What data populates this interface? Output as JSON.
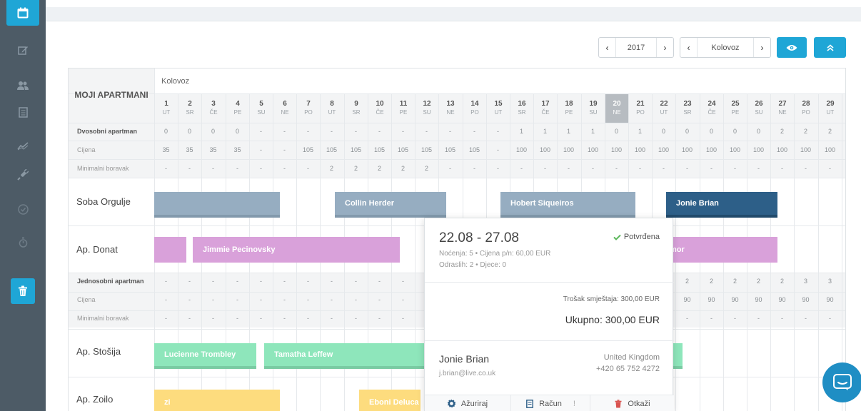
{
  "toolbar": {
    "year": "2017",
    "month": "Kolovoz",
    "prev": "‹",
    "next": "›",
    "view_icon": "eye-icon",
    "collapse_icon": "double-chevron-up-icon"
  },
  "sidebar": {
    "icons": [
      "calendar-icon",
      "edit-icon",
      "users-icon",
      "document-icon",
      "chart-icon",
      "plug-icon",
      "check-circle-icon",
      "timer-icon",
      "trash-icon"
    ]
  },
  "calendar": {
    "header_label": "MOJI APARTMANI",
    "month_label": "Kolovoz",
    "days": [
      {
        "n": "1",
        "w": "UT"
      },
      {
        "n": "2",
        "w": "SR"
      },
      {
        "n": "3",
        "w": "ČE"
      },
      {
        "n": "4",
        "w": "PE"
      },
      {
        "n": "5",
        "w": "SU"
      },
      {
        "n": "6",
        "w": "NE"
      },
      {
        "n": "7",
        "w": "PO"
      },
      {
        "n": "8",
        "w": "UT"
      },
      {
        "n": "9",
        "w": "SR"
      },
      {
        "n": "10",
        "w": "ČE"
      },
      {
        "n": "11",
        "w": "PE"
      },
      {
        "n": "12",
        "w": "SU"
      },
      {
        "n": "13",
        "w": "NE"
      },
      {
        "n": "14",
        "w": "PO"
      },
      {
        "n": "15",
        "w": "UT"
      },
      {
        "n": "16",
        "w": "SR"
      },
      {
        "n": "17",
        "w": "ČE"
      },
      {
        "n": "18",
        "w": "PE"
      },
      {
        "n": "19",
        "w": "SU"
      },
      {
        "n": "20",
        "w": "NE"
      },
      {
        "n": "21",
        "w": "PO"
      },
      {
        "n": "22",
        "w": "UT"
      },
      {
        "n": "23",
        "w": "SR"
      },
      {
        "n": "24",
        "w": "ČE"
      },
      {
        "n": "25",
        "w": "PE"
      },
      {
        "n": "26",
        "w": "SU"
      },
      {
        "n": "27",
        "w": "NE"
      },
      {
        "n": "28",
        "w": "PO"
      },
      {
        "n": "29",
        "w": "UT"
      }
    ],
    "today_index": 19,
    "groups": [
      {
        "name": "Dvosobni apartman",
        "price_label": "Cijena",
        "min_label": "Minimalni boravak",
        "availability": [
          "0",
          "0",
          "0",
          "0",
          "-",
          "-",
          "-",
          "-",
          "-",
          "-",
          "-",
          "-",
          "-",
          "-",
          "-",
          "1",
          "1",
          "1",
          "1",
          "0",
          "1",
          "0",
          "0",
          "0",
          "0",
          "0",
          "2",
          "2",
          "2"
        ],
        "prices": [
          "35",
          "35",
          "35",
          "35",
          "-",
          "-",
          "105",
          "105",
          "105",
          "105",
          "105",
          "105",
          "105",
          "105",
          "-",
          "100",
          "100",
          "100",
          "100",
          "100",
          "100",
          "100",
          "100",
          "100",
          "100",
          "100",
          "100",
          "100",
          "100"
        ],
        "min_stay": [
          "-",
          "-",
          "-",
          "-",
          "-",
          "-",
          "-",
          "2",
          "2",
          "2",
          "2",
          "2",
          "-",
          "-",
          "-",
          "-",
          "-",
          "-",
          "-",
          "-",
          "-",
          "-",
          "-",
          "-",
          "-",
          "-",
          "-",
          "-",
          "-"
        ],
        "units": [
          {
            "name": "Soba Orgulje",
            "bookings": [
              {
                "guest": "",
                "color": "blue"
              },
              {
                "guest": "Collin Herder",
                "color": "blue"
              },
              {
                "guest": "Hobert Siqueiros",
                "color": "blue"
              },
              {
                "guest": "Jonie Brian",
                "color": "navy"
              }
            ]
          },
          {
            "name": "Ap. Donat",
            "bookings": [
              {
                "guest": "",
                "color": "pink"
              },
              {
                "guest": "Jimmie Pecinovsky",
                "color": "pink"
              },
              {
                "guest": "mor",
                "color": "pink"
              }
            ]
          }
        ]
      },
      {
        "name": "Jednosobni apartman",
        "price_label": "Cijena",
        "min_label": "Minimalni boravak",
        "availability": [
          "-",
          "-",
          "-",
          "-",
          "-",
          "-",
          "-",
          "-",
          "-",
          "-",
          "-",
          "-",
          "-",
          "-",
          "-",
          "-",
          "-",
          "-",
          "-",
          "-",
          "-",
          "-",
          "2",
          "2",
          "2",
          "2",
          "2",
          "3",
          "3"
        ],
        "prices": [
          "-",
          "-",
          "-",
          "-",
          "-",
          "-",
          "-",
          "-",
          "-",
          "-",
          "-",
          "-",
          "-",
          "-",
          "-",
          "-",
          "-",
          "-",
          "-",
          "-",
          "-",
          "-",
          "90",
          "90",
          "90",
          "90",
          "90",
          "90",
          "90"
        ],
        "min_stay": [
          "-",
          "-",
          "-",
          "-",
          "-",
          "-",
          "-",
          "-",
          "-",
          "-",
          "-",
          "-",
          "-",
          "-",
          "-",
          "-",
          "-",
          "-",
          "-",
          "-",
          "-",
          "-",
          "-",
          "-",
          "-",
          "-",
          "-",
          "-",
          "-"
        ],
        "units": [
          {
            "name": "Ap. Stošija",
            "bookings": [
              {
                "guest": "Lucienne Trombley",
                "color": "green"
              },
              {
                "guest": "Tamatha Leffew",
                "color": "green"
              },
              {
                "guest": "",
                "color": "green"
              }
            ]
          },
          {
            "name": "Ap. Zoilo",
            "bookings": [
              {
                "guest": "zi",
                "color": "yellow"
              },
              {
                "guest": "Eboni Deluca",
                "color": "yellow"
              }
            ]
          }
        ]
      }
    ]
  },
  "popup": {
    "dates": "22.08 - 27.08",
    "status": "Potvrđena",
    "details_line1": "Noćenja: 5 • Cijena p/n: 60,00 EUR",
    "details_line2": "Odraslih: 2 • Djece: 0",
    "cost_label": "Trošak smještaja: 300,00 EUR",
    "total_label": "Ukupno: 300,00 EUR",
    "guest_name": "Jonie Brian",
    "guest_email": "j.brian@live.co.uk",
    "country": "United Kingdom",
    "phone": "+420 65 752 4272",
    "actions": {
      "update": "Ažuriraj",
      "invoice": "Račun",
      "invoice_badge": "!",
      "cancel": "Otkaži"
    }
  },
  "colors": {
    "accent": "#1fa6d6",
    "sidebar": "#4d5b66",
    "confirmed": "#5cb85c",
    "booking_blue": "#96adc1",
    "booking_navy": "#2d5f88",
    "booking_pink": "#d9a1da",
    "booking_green": "#8ee6bb",
    "booking_yellow": "#fddc7e"
  },
  "chat_icon": "chat-bubble-icon"
}
